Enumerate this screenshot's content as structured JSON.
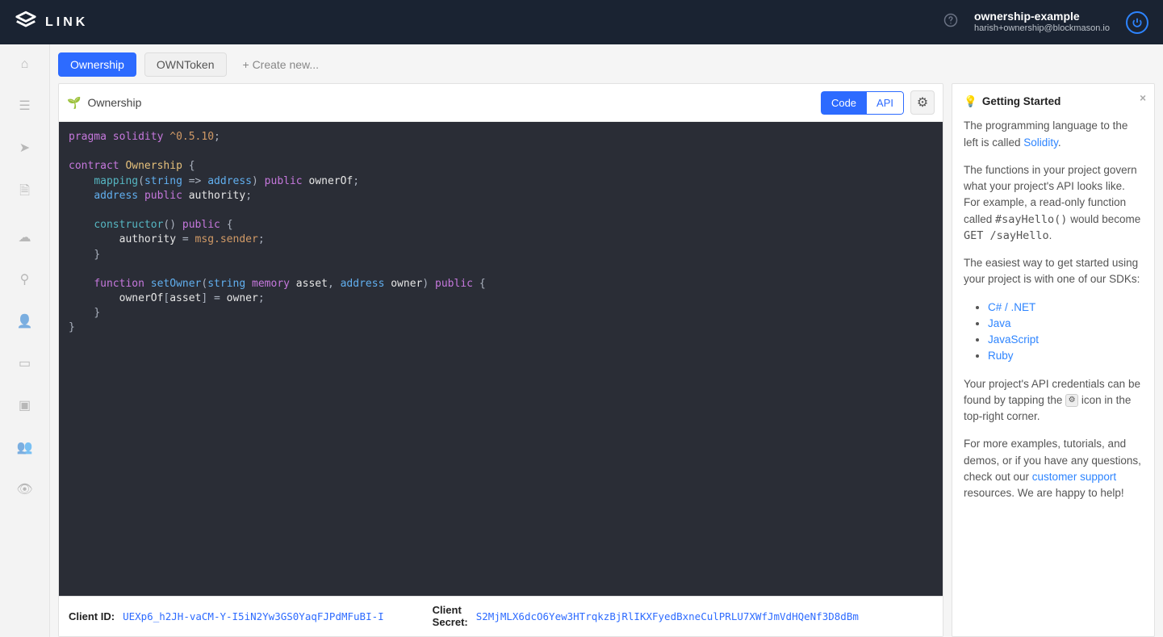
{
  "header": {
    "brand": "LINK",
    "account_name": "ownership-example",
    "account_email": "harish+ownership@blockmason.io"
  },
  "tabs": {
    "items": [
      {
        "label": "Ownership",
        "active": true
      },
      {
        "label": "OWNToken",
        "active": false
      }
    ],
    "create_label": "+ Create new..."
  },
  "editor": {
    "title": "Ownership",
    "code_btn": "Code",
    "api_btn": "API",
    "source_html": "<span class='t-kw'>pragma</span> <span class='t-kw'>solidity</span> <span class='t-num'>^0.5.10</span><span class='t-punc'>;</span>\n\n<span class='t-kw'>contract</span> <span class='t-name'>Ownership</span> <span class='t-punc'>{</span>\n    <span class='t-kw2'>mapping</span><span class='t-punc'>(</span><span class='t-type'>string</span> <span class='t-punc'>=&gt;</span> <span class='t-type'>address</span><span class='t-punc'>)</span> <span class='t-kw'>public</span> ownerOf<span class='t-punc'>;</span>\n    <span class='t-type'>address</span> <span class='t-kw'>public</span> authority<span class='t-punc'>;</span>\n\n    <span class='t-kw2'>constructor</span><span class='t-punc'>()</span> <span class='t-kw'>public</span> <span class='t-punc'>{</span>\n        authority <span class='t-punc'>=</span> <span class='t-builtin'>msg.sender</span><span class='t-punc'>;</span>\n    <span class='t-punc'>}</span>\n\n    <span class='t-kw'>function</span> <span class='t-func'>setOwner</span><span class='t-punc'>(</span><span class='t-type'>string</span> <span class='t-kw'>memory</span> asset<span class='t-punc'>,</span> <span class='t-type'>address</span> owner<span class='t-punc'>)</span> <span class='t-kw'>public</span> <span class='t-punc'>{</span>\n        ownerOf<span class='t-punc'>[</span>asset<span class='t-punc'>]</span> <span class='t-punc'>=</span> owner<span class='t-punc'>;</span>\n    <span class='t-punc'>}</span>\n<span class='t-punc'>}</span>"
  },
  "credentials": {
    "client_id_label": "Client ID:",
    "client_id": "UEXp6_h2JH-vaCM-Y-I5iN2Yw3GS0YaqFJPdMFuBI-I",
    "client_secret_label_l1": "Client",
    "client_secret_label_l2": "Secret:",
    "client_secret": "S2MjMLX6dcO6Yew3HTrqkzBjRlIKXFyedBxneCulPRLU7XWfJmVdHQeNf3D8dBm"
  },
  "panel": {
    "title": "Getting Started",
    "p1_a": "The programming language to the left is called ",
    "p1_link": "Solidity",
    "p1_b": ".",
    "p2_a": "The functions in your project govern what your project's API looks like. For example, a read-only function called ",
    "p2_code1": "#sayHello()",
    "p2_b": " would become ",
    "p2_code2": "GET /sayHello",
    "p2_c": ".",
    "p3": "The easiest way to get started using your project is with one of our SDKs:",
    "sdks": [
      "C# / .NET",
      "Java",
      "JavaScript",
      "Ruby"
    ],
    "p4_a": "Your project's API credentials can be found by tapping the ",
    "p4_b": " icon in the top-right corner.",
    "p5_a": "For more examples, tutorials, and demos, or if you have any questions, check out our ",
    "p5_link": "customer support",
    "p5_b": " resources. We are happy to help!"
  }
}
